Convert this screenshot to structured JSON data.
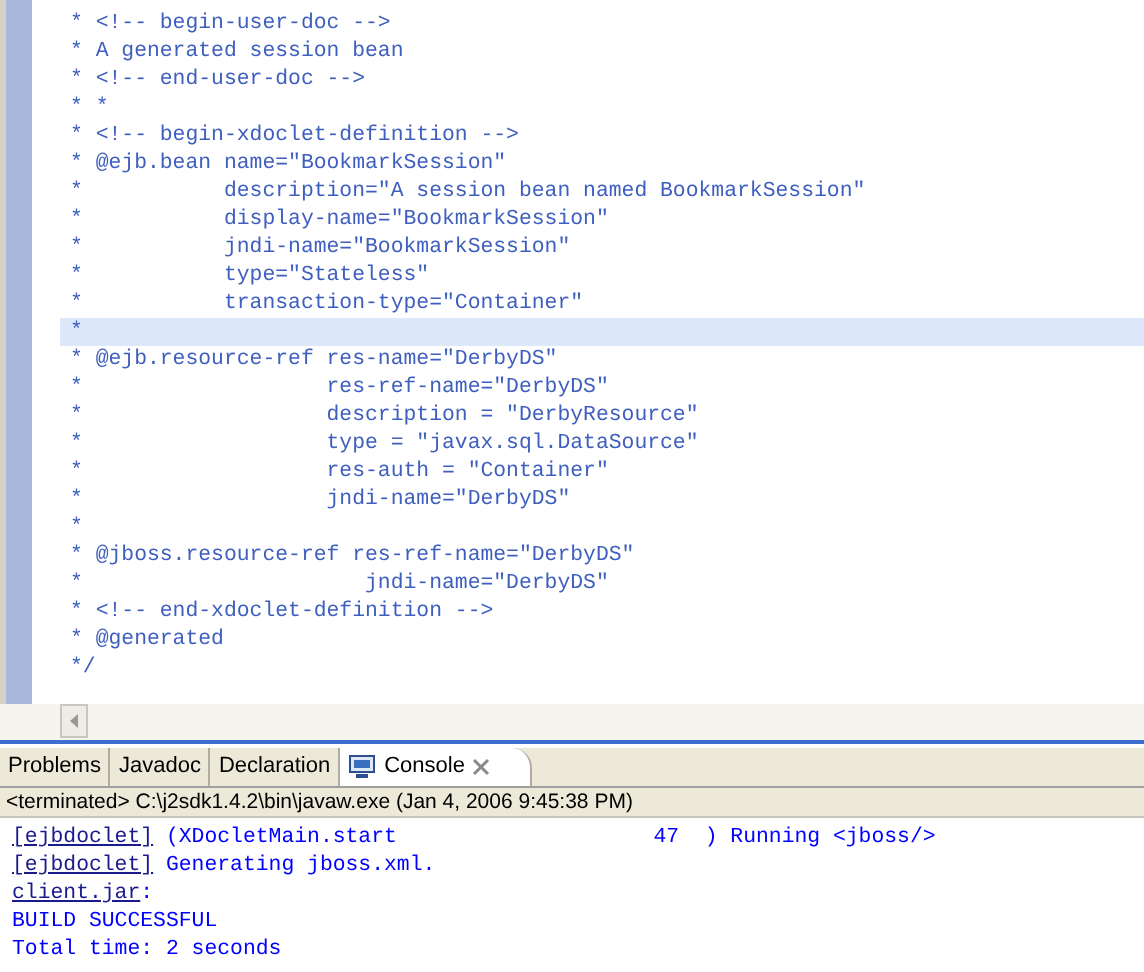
{
  "editor": {
    "lines": [
      {
        "text": "* <!-- begin-user-doc -->",
        "current": false
      },
      {
        "text": "* A generated session bean",
        "current": false
      },
      {
        "text": "* <!-- end-user-doc -->",
        "current": false
      },
      {
        "text": "* *",
        "current": false
      },
      {
        "text": "* <!-- begin-xdoclet-definition -->",
        "current": false
      },
      {
        "text": "* @ejb.bean name=\"BookmarkSession\"",
        "current": false
      },
      {
        "text": "*           description=\"A session bean named BookmarkSession\"",
        "current": false
      },
      {
        "text": "*           display-name=\"BookmarkSession\"",
        "current": false
      },
      {
        "text": "*           jndi-name=\"BookmarkSession\"",
        "current": false
      },
      {
        "text": "*           type=\"Stateless\"",
        "current": false
      },
      {
        "text": "*           transaction-type=\"Container\"",
        "current": false
      },
      {
        "text": "*",
        "current": true
      },
      {
        "text": "* @ejb.resource-ref res-name=\"DerbyDS\"",
        "current": false
      },
      {
        "text": "*                   res-ref-name=\"DerbyDS\"",
        "current": false
      },
      {
        "text": "*                   description = \"DerbyResource\"",
        "current": false
      },
      {
        "text": "*                   type = \"javax.sql.DataSource\"",
        "current": false
      },
      {
        "text": "*                   res-auth = \"Container\"",
        "current": false
      },
      {
        "text": "*                   jndi-name=\"DerbyDS\"",
        "current": false
      },
      {
        "text": "*",
        "current": false
      },
      {
        "text": "* @jboss.resource-ref res-ref-name=\"DerbyDS\"",
        "current": false
      },
      {
        "text": "*                      jndi-name=\"DerbyDS\"",
        "current": false
      },
      {
        "text": "* <!-- end-xdoclet-definition -->",
        "current": false
      },
      {
        "text": "* @generated",
        "current": false
      },
      {
        "text": "*/",
        "current": false
      }
    ]
  },
  "tabs": [
    {
      "label": "Problems",
      "selected": false
    },
    {
      "label": "Javadoc",
      "selected": false
    },
    {
      "label": "Declaration",
      "selected": false
    },
    {
      "label": "Console",
      "selected": true
    }
  ],
  "console": {
    "status": "<terminated> C:\\j2sdk1.4.2\\bin\\javaw.exe (Jan 4, 2006 9:45:38 PM)",
    "lines": [
      [
        {
          "text": "[ejbdoclet]",
          "link": true
        },
        {
          "text": " (XDocletMain.start                    47  ) Running <jboss/>",
          "link": false
        }
      ],
      [
        {
          "text": "[ejbdoclet]",
          "link": true
        },
        {
          "text": " Generating jboss.xml.",
          "link": false
        }
      ],
      [
        {
          "text": "client.jar",
          "link": true
        },
        {
          "text": ":",
          "link": false
        }
      ],
      [
        {
          "text": "BUILD SUCCESSFUL",
          "link": false
        }
      ],
      [
        {
          "text": "Total time: 2 seconds",
          "link": false
        }
      ]
    ]
  }
}
